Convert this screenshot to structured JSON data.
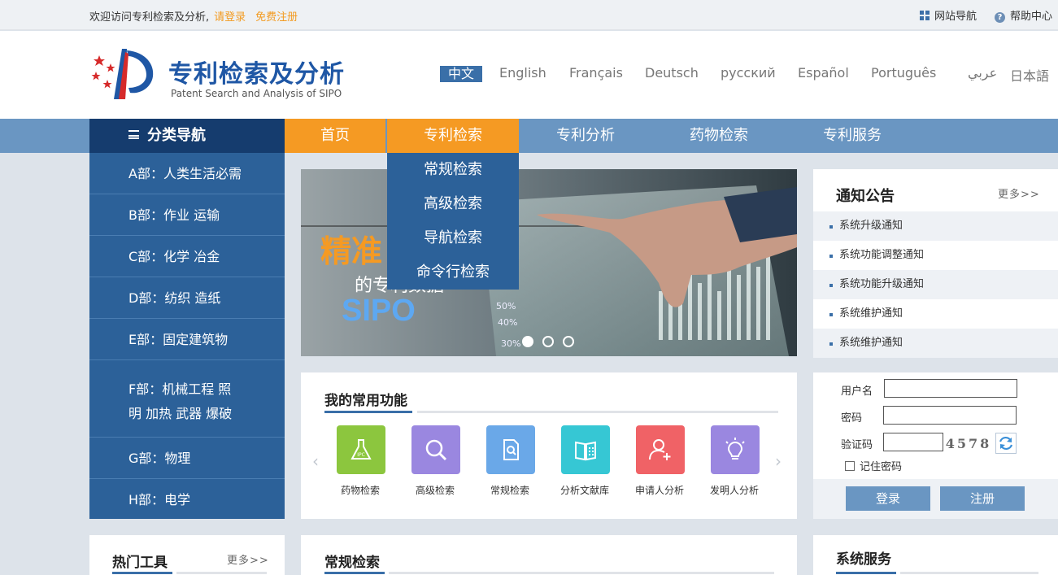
{
  "topbar": {
    "welcome": "欢迎访问专利检索及分析,",
    "login_link": "请登录",
    "register_link": "免费注册",
    "site_nav": "网站导航",
    "help": "帮助中心"
  },
  "header": {
    "logo_title": "专利检索及分析",
    "logo_subtitle": "Patent Search and Analysis of SIPO",
    "languages": [
      "中文",
      "English",
      "Français",
      "Deutsch",
      "русский",
      "Español",
      "Português",
      "عربي",
      "日本語"
    ]
  },
  "nav": {
    "category_label": "分类导航",
    "items": [
      "首页",
      "专利检索",
      "专利分析",
      "药物检索",
      "专利服务"
    ],
    "dropdown": [
      "常规检索",
      "高级检索",
      "导航检索",
      "命令行检索"
    ]
  },
  "categories": [
    {
      "line1": "A部：人类生活必需"
    },
    {
      "line1": "B部：作业  运输"
    },
    {
      "line1": "C部：化学  冶金"
    },
    {
      "line1": "D部：纺织  造纸"
    },
    {
      "line1": "E部：固定建筑物"
    },
    {
      "line1": "F部：机械工程  照",
      "line2": "明  加热  武器  爆破"
    },
    {
      "line1": "G部：物理"
    },
    {
      "line1": "H部：电学"
    }
  ],
  "banner": {
    "headline": "精准",
    "subline": "的专利数据",
    "brand": "SIPO",
    "pct_labels": [
      "50%",
      "40%",
      "30%"
    ]
  },
  "notice": {
    "title": "通知公告",
    "more": "更多>>",
    "items": [
      "系统升级通知",
      "系统功能调整通知",
      "系统功能升级通知",
      "系统维护通知",
      "系统维护通知"
    ]
  },
  "common_functions": {
    "title": "我的常用功能",
    "tiles": [
      {
        "label": "药物检索",
        "icon": "flask-icon",
        "color": "#8cc63e"
      },
      {
        "label": "高级检索",
        "icon": "search-icon",
        "color": "#9a87e0"
      },
      {
        "label": "常规检索",
        "icon": "document-search-icon",
        "color": "#6aa8e8"
      },
      {
        "label": "分析文献库",
        "icon": "book-icon",
        "color": "#36c7d4"
      },
      {
        "label": "申请人分析",
        "icon": "add-user-icon",
        "color": "#f06266"
      },
      {
        "label": "发明人分析",
        "icon": "lightbulb-icon",
        "color": "#9a87e0"
      }
    ]
  },
  "login": {
    "username_label": "用户名",
    "password_label": "密码",
    "captcha_label": "验证码",
    "captcha_text": "4578",
    "remember_label": "记住密码",
    "login_button": "登录",
    "register_button": "注册"
  },
  "bottom_panels": {
    "hot_tools": "热门工具",
    "hot_tools_more": "更多>>",
    "regular_search": "常规检索",
    "system_service": "系统服务"
  },
  "colors": {
    "primary_blue": "#2c6199",
    "nav_blue": "#6a96c2",
    "dark_blue": "#153c6e",
    "accent_orange": "#f59a23"
  }
}
